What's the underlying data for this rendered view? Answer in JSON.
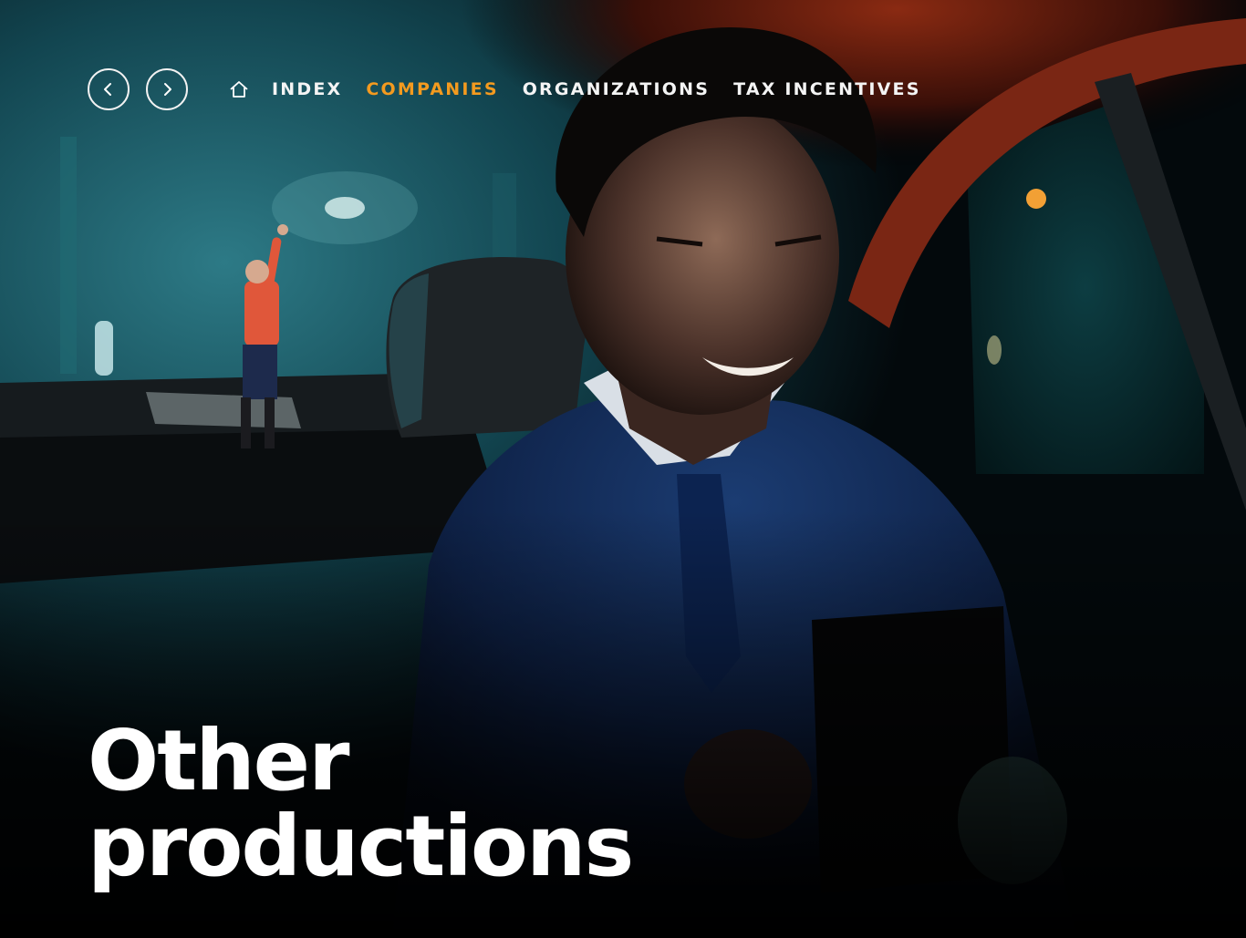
{
  "nav": {
    "prev_icon": "chevron-left-icon",
    "next_icon": "chevron-right-icon",
    "home_icon": "home-icon",
    "items": [
      {
        "label": "INDEX",
        "active": false
      },
      {
        "label": "COMPANIES",
        "active": true
      },
      {
        "label": "ORGANIZATIONS",
        "active": false
      },
      {
        "label": "TAX INCENTIVES",
        "active": false
      }
    ],
    "active_color": "#f39a1f",
    "text_color": "#f4f4f4"
  },
  "hero": {
    "title_line1": "Other",
    "title_line2": "productions"
  }
}
